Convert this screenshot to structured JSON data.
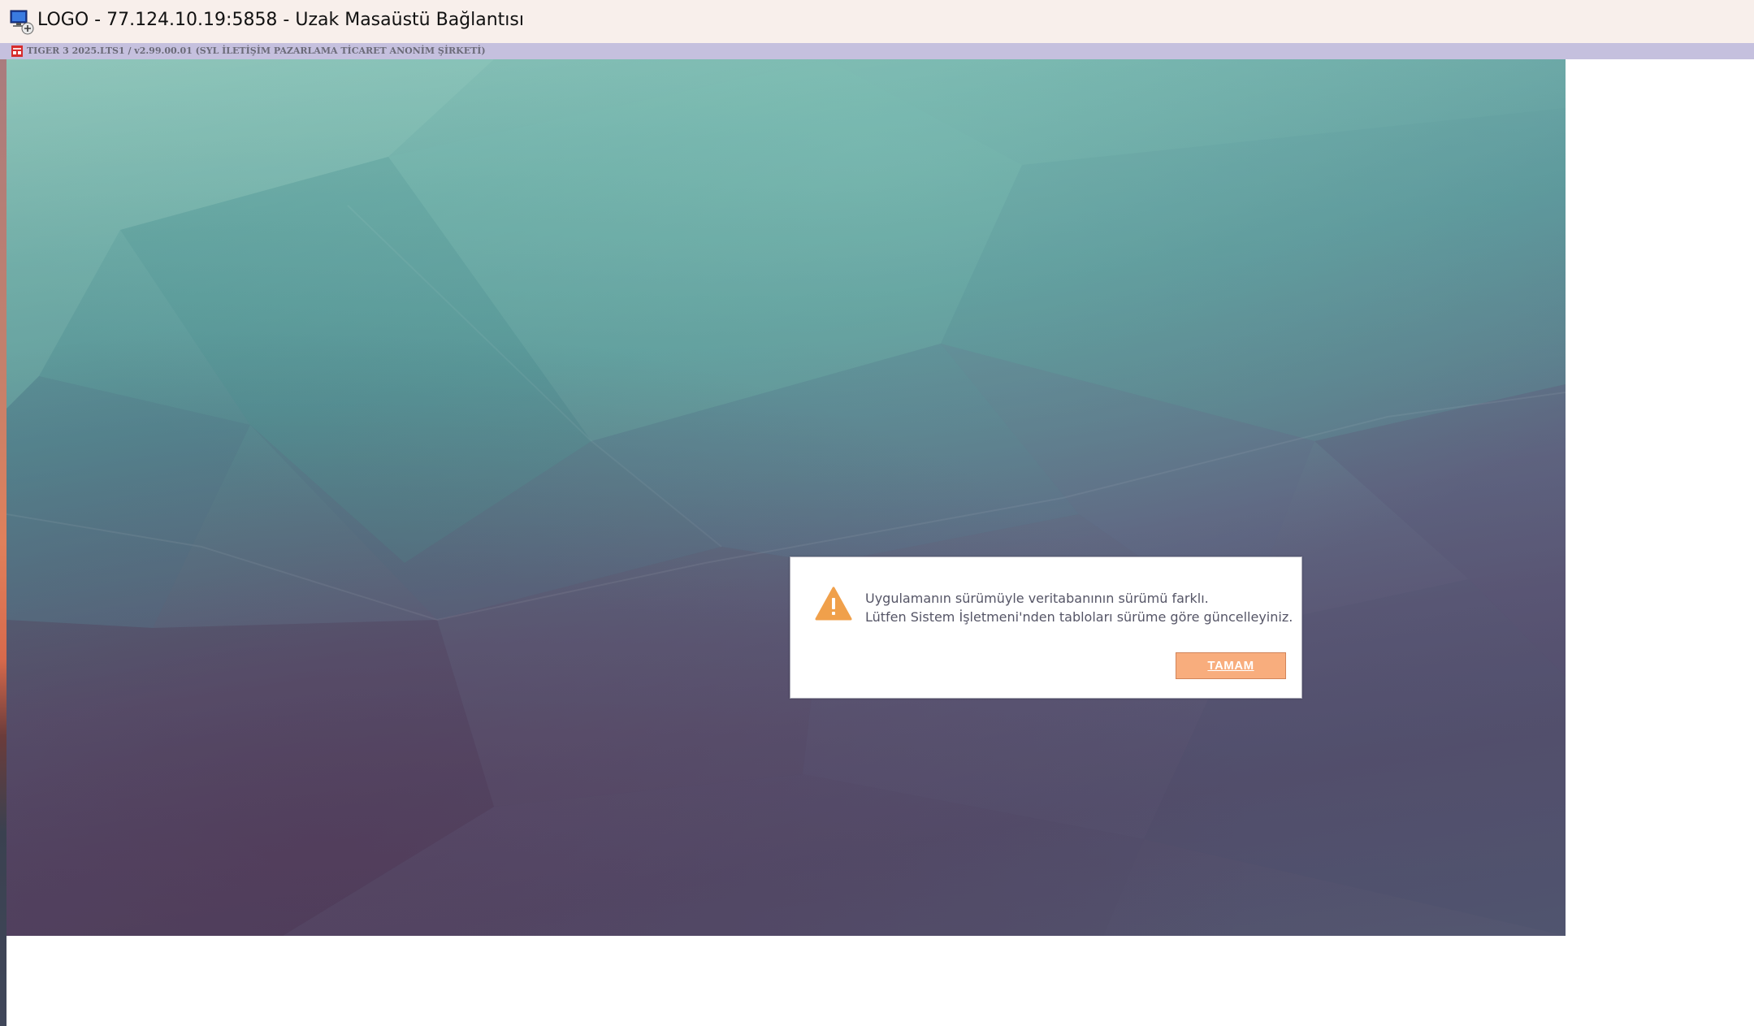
{
  "window": {
    "title": "LOGO - 77.124.10.19:5858 - Uzak Masaüstü Bağlantısı",
    "icon": "remote-desktop-icon"
  },
  "app": {
    "caption": "TIGER 3 2025.LTS1 / v2.99.00.01 (SYL İLETİŞİM PAZARLAMA TİCARET ANONİM ŞİRKETİ)",
    "icon": "logo-app-icon"
  },
  "dialog": {
    "icon": "warning-icon",
    "message_line1": "Uygulamanın sürümüyle veritabanının sürümü farklı.",
    "message_line2": "Lütfen Sistem İşletmeni'nden tabloları sürüme göre güncelleyiniz.",
    "ok_label": "TAMAM"
  },
  "colors": {
    "titlebar_bg": "#f8efeb",
    "caption_bg": "#c5c0de",
    "warning": "#f0a04b",
    "button_bg": "#f8ad7d"
  }
}
